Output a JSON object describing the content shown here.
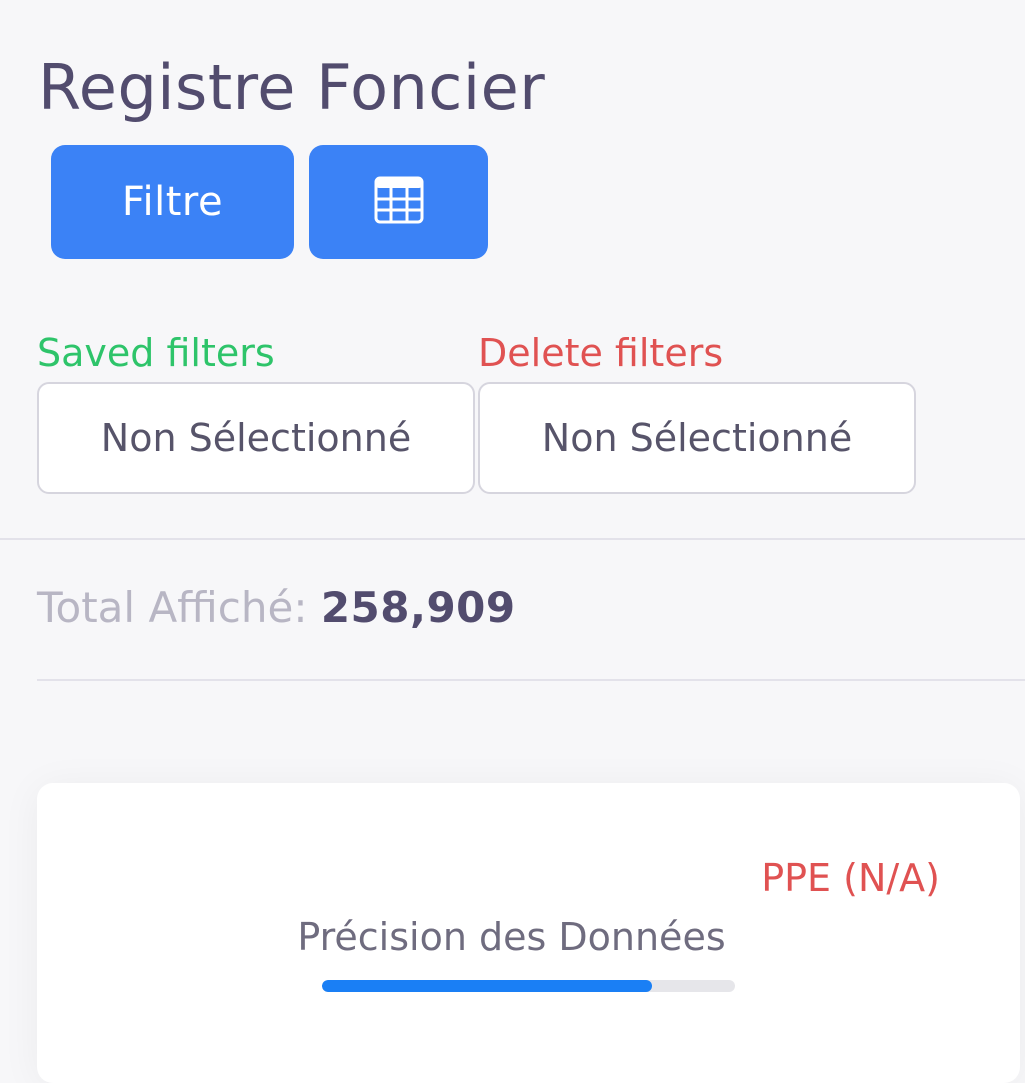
{
  "header": {
    "title": "Registre Foncier"
  },
  "toolbar": {
    "filter_label": "Filtre",
    "table_icon": "table-grid-icon"
  },
  "filters": {
    "saved_label": "Saved filters",
    "saved_value": "Non Sélectionné",
    "delete_label": "Delete filters",
    "delete_value": "Non Sélectionné"
  },
  "summary": {
    "total_label": "Total Affiché: ",
    "total_value": "258,909"
  },
  "card": {
    "ppe_label": "PPE (N/A)",
    "precision_label": "Précision des Données",
    "precision_progress": 0.8
  },
  "colors": {
    "accent": "#3b82f6",
    "saved": "#2ec46a",
    "delete": "#e05252",
    "progress": "#1a7ff5",
    "title": "#524c6e"
  }
}
